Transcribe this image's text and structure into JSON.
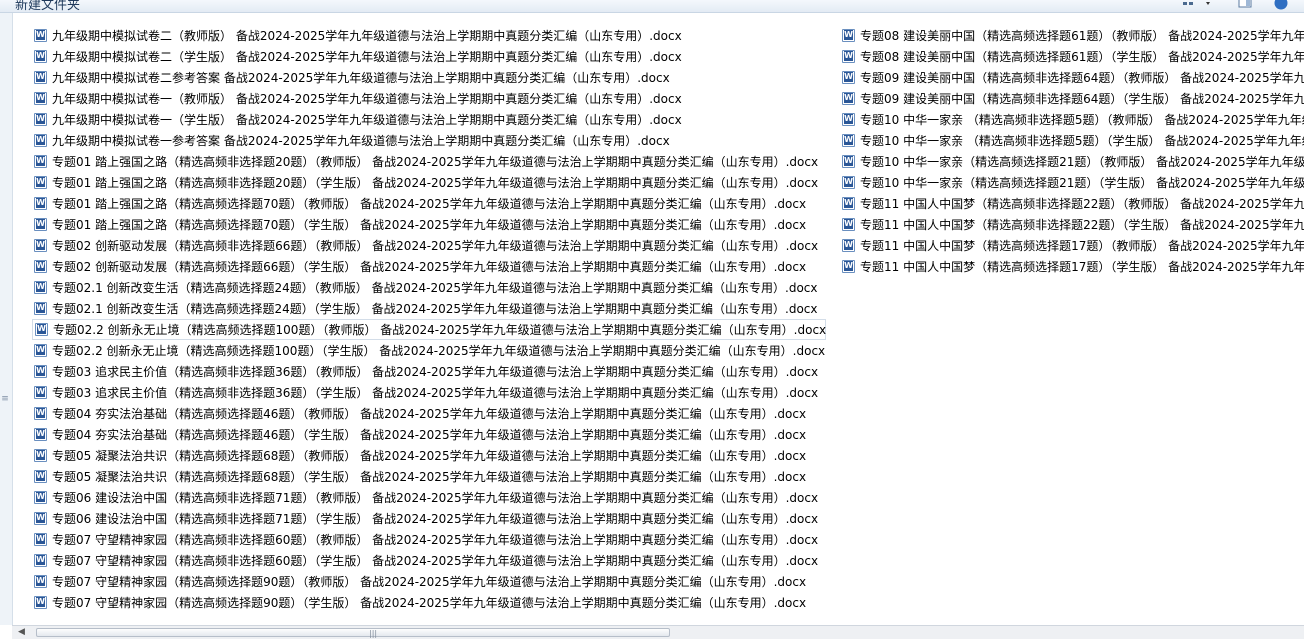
{
  "toolbar": {
    "new_folder_label": "新建文件夹",
    "view_icon": "view-options-icon",
    "preview_icon": "preview-pane-icon",
    "help_icon": "help-icon"
  },
  "files_col1": [
    "九年级期中模拟试卷二（教师版） 备战2024-2025学年九年级道德与法治上学期期中真题分类汇编（山东专用）.docx",
    "九年级期中模拟试卷二（学生版） 备战2024-2025学年九年级道德与法治上学期期中真题分类汇编（山东专用）.docx",
    "九年级期中模拟试卷二参考答案 备战2024-2025学年九年级道德与法治上学期期中真题分类汇编（山东专用）.docx",
    "九年级期中模拟试卷一（教师版） 备战2024-2025学年九年级道德与法治上学期期中真题分类汇编（山东专用）.docx",
    "九年级期中模拟试卷一（学生版） 备战2024-2025学年九年级道德与法治上学期期中真题分类汇编（山东专用）.docx",
    "九年级期中模拟试卷一参考答案 备战2024-2025学年九年级道德与法治上学期期中真题分类汇编（山东专用）.docx",
    "专题01 踏上强国之路（精选高频非选择题20题）（教师版） 备战2024-2025学年九年级道德与法治上学期期中真题分类汇编（山东专用）.docx",
    "专题01 踏上强国之路（精选高频非选择题20题）（学生版） 备战2024-2025学年九年级道德与法治上学期期中真题分类汇编（山东专用）.docx",
    "专题01 踏上强国之路（精选高频选择题70题）（教师版） 备战2024-2025学年九年级道德与法治上学期期中真题分类汇编（山东专用）.docx",
    "专题01 踏上强国之路（精选高频选择题70题）（学生版） 备战2024-2025学年九年级道德与法治上学期期中真题分类汇编（山东专用）.docx",
    "专题02 创新驱动发展（精选高频非选择题66题）（教师版） 备战2024-2025学年九年级道德与法治上学期期中真题分类汇编（山东专用）.docx",
    "专题02 创新驱动发展（精选高频选择题66题）（学生版） 备战2024-2025学年九年级道德与法治上学期期中真题分类汇编（山东专用）.docx",
    "专题02.1 创新改变生活（精选高频选择题24题）（教师版） 备战2024-2025学年九年级道德与法治上学期期中真题分类汇编（山东专用）.docx",
    "专题02.1 创新改变生活（精选高频选择题24题）（学生版） 备战2024-2025学年九年级道德与法治上学期期中真题分类汇编（山东专用）.docx",
    "专题02.2 创新永无止境（精选高频选择题100题）（教师版） 备战2024-2025学年九年级道德与法治上学期期中真题分类汇编（山东专用）.docx",
    "专题02.2 创新永无止境（精选高频选择题100题）（学生版） 备战2024-2025学年九年级道德与法治上学期期中真题分类汇编（山东专用）.docx",
    "专题03 追求民主价值（精选高频非选择题36题）（教师版） 备战2024-2025学年九年级道德与法治上学期期中真题分类汇编（山东专用）.docx",
    "专题03 追求民主价值（精选高频非选择题36题）（学生版） 备战2024-2025学年九年级道德与法治上学期期中真题分类汇编（山东专用）.docx",
    "专题04 夯实法治基础（精选高频选择题46题）（教师版） 备战2024-2025学年九年级道德与法治上学期期中真题分类汇编（山东专用）.docx",
    "专题04 夯实法治基础（精选高频选择题46题）（学生版） 备战2024-2025学年九年级道德与法治上学期期中真题分类汇编（山东专用）.docx",
    "专题05 凝聚法治共识（精选高频选择题68题）（教师版） 备战2024-2025学年九年级道德与法治上学期期中真题分类汇编（山东专用）.docx",
    "专题05 凝聚法治共识（精选高频选择题68题）（学生版） 备战2024-2025学年九年级道德与法治上学期期中真题分类汇编（山东专用）.docx",
    "专题06 建设法治中国（精选高频非选择题71题）（教师版） 备战2024-2025学年九年级道德与法治上学期期中真题分类汇编（山东专用）.docx",
    "专题06 建设法治中国（精选高频非选择题71题）（学生版） 备战2024-2025学年九年级道德与法治上学期期中真题分类汇编（山东专用）.docx",
    "专题07 守望精神家园（精选高频非选择题60题）（教师版） 备战2024-2025学年九年级道德与法治上学期期中真题分类汇编（山东专用）.docx",
    "专题07 守望精神家园（精选高频非选择题60题）（学生版） 备战2024-2025学年九年级道德与法治上学期期中真题分类汇编（山东专用）.docx",
    "专题07 守望精神家园（精选高频选择题90题）（教师版） 备战2024-2025学年九年级道德与法治上学期期中真题分类汇编（山东专用）.docx",
    "专题07 守望精神家园（精选高频选择题90题）（学生版） 备战2024-2025学年九年级道德与法治上学期期中真题分类汇编（山东专用）.docx"
  ],
  "files_col2": [
    "专题08 建设美丽中国（精选高频选择题61题）（教师版） 备战2024-2025学年九年",
    "专题08 建设美丽中国（精选高频选择题61题）（学生版） 备战2024-2025学年九年",
    "专题09 建设美丽中国（精选高频非选择题64题）（教师版） 备战2024-2025学年九",
    "专题09 建设美丽中国（精选高频非选择题64题）（学生版） 备战2024-2025学年九",
    "专题10 中华一家亲 （精选高频非选择题5题）（教师版） 备战2024-2025学年九年级",
    "专题10 中华一家亲 （精选高频非选择题5题）（学生版） 备战2024-2025学年九年级",
    "专题10 中华一家亲（精选高频选择题21题）（教师版） 备战2024-2025学年九年级",
    "专题10 中华一家亲（精选高频选择题21题）（学生版） 备战2024-2025学年九年级",
    "专题11 中国人中国梦（精选高频非选择题22题）（教师版） 备战2024-2025学年九",
    "专题11 中国人中国梦（精选高频非选择题22题）（学生版） 备战2024-2025学年九",
    "专题11 中国人中国梦（精选高频选择题17题）（教师版） 备战2024-2025学年九年",
    "专题11 中国人中国梦（精选高频选择题17题）（学生版） 备战2024-2025学年九年"
  ],
  "selected_index": 14
}
